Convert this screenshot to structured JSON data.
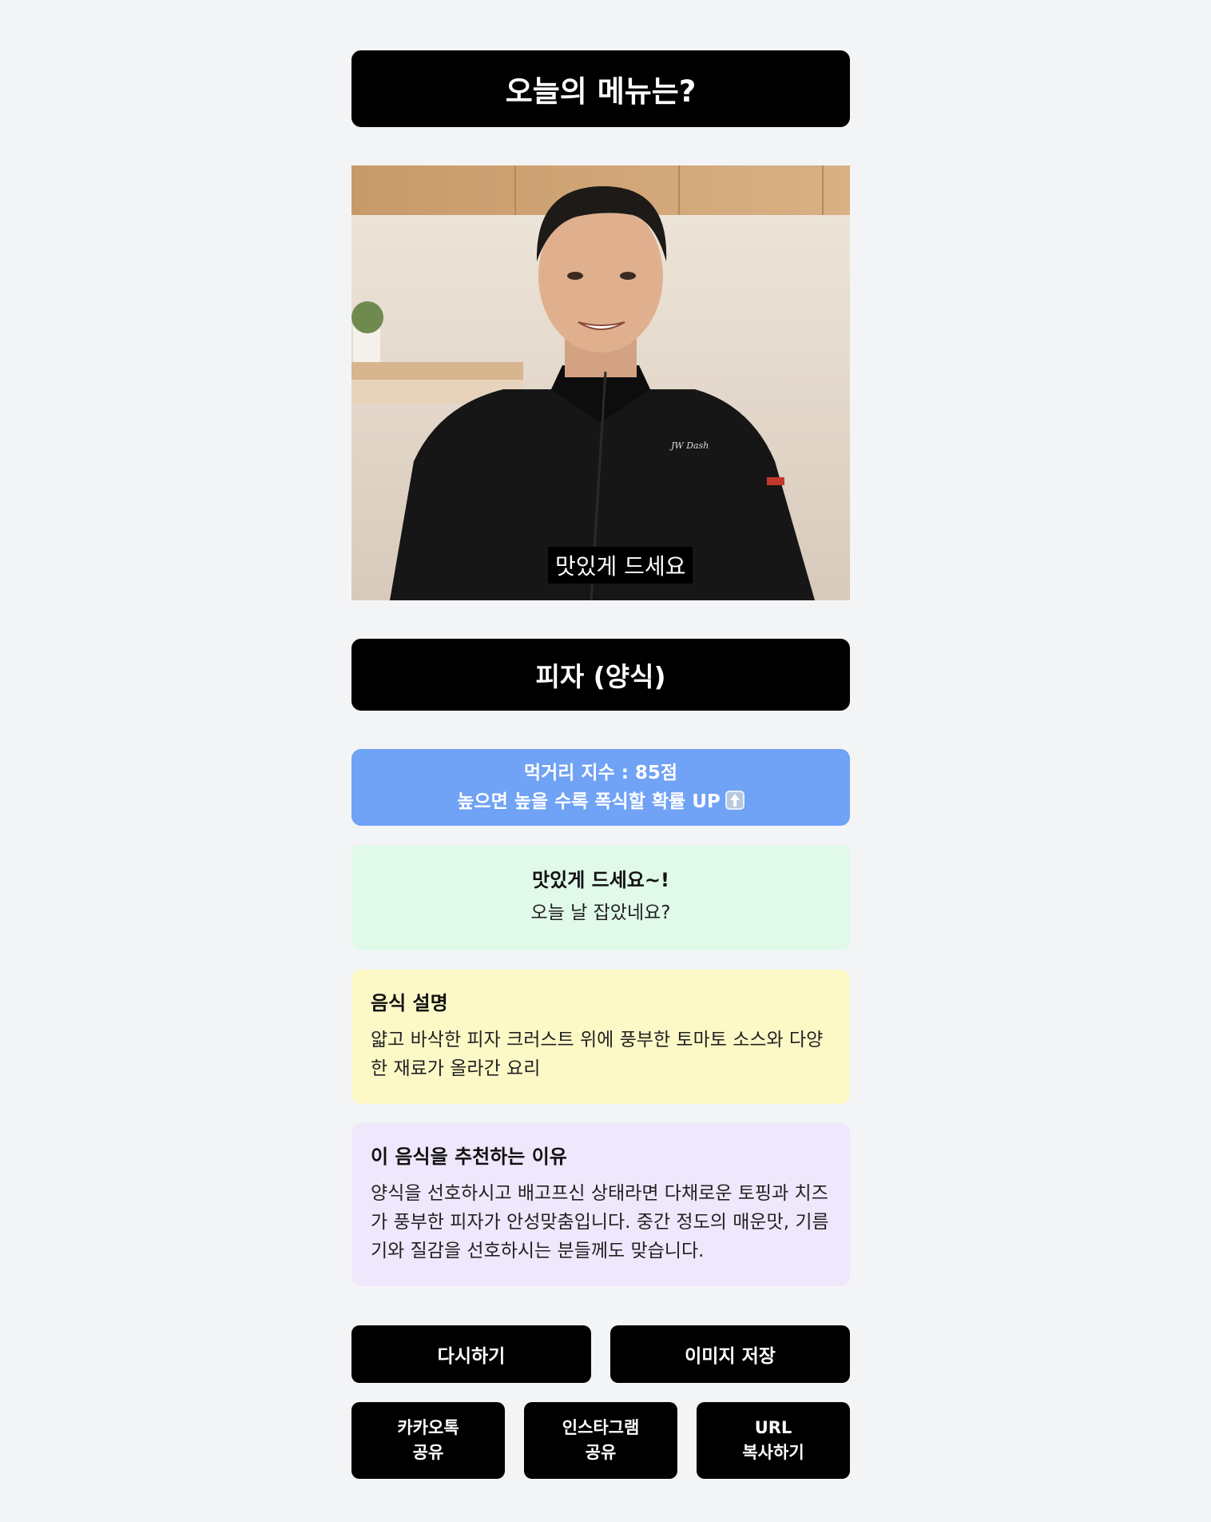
{
  "header": {
    "title": "오늘의 메뉴는?"
  },
  "photo": {
    "caption": "맛있게 드세요"
  },
  "result": {
    "menu_name": "피자 (양식)"
  },
  "score": {
    "line1": "먹거리 지수 : 85점",
    "line2": "높으면 높을 수록 폭식할 확률 UP",
    "icon": "up-arrow-icon"
  },
  "message": {
    "title": "맛있게 드세요~!",
    "subtitle": "오늘 날 잡았네요?"
  },
  "description": {
    "title": "음식 설명",
    "text": "얇고 바삭한 피자 크러스트 위에 풍부한 토마토 소스와 다양한 재료가 올라간 요리"
  },
  "reason": {
    "title": "이 음식을 추천하는 이유",
    "text": "양식을 선호하시고 배고프신 상태라면 다채로운 토핑과 치즈가 풍부한 피자가 안성맞춤입니다. 중간 정도의 매운맛, 기름기와 질감을 선호하시는 분들께도 맞습니다."
  },
  "actions": {
    "retry": "다시하기",
    "save_image": "이미지 저장",
    "kakao_line1": "카카오톡",
    "kakao_line2": "공유",
    "insta_line1": "인스타그램",
    "insta_line2": "공유",
    "url_line1": "URL",
    "url_line2": "복사하기"
  },
  "colors": {
    "background": "#f3f4f6",
    "score_box": "#70a2f5",
    "message_box": "#e0f9e9",
    "description_box": "#fdf9c7",
    "reason_box": "#efe7fc",
    "button": "#000000"
  }
}
